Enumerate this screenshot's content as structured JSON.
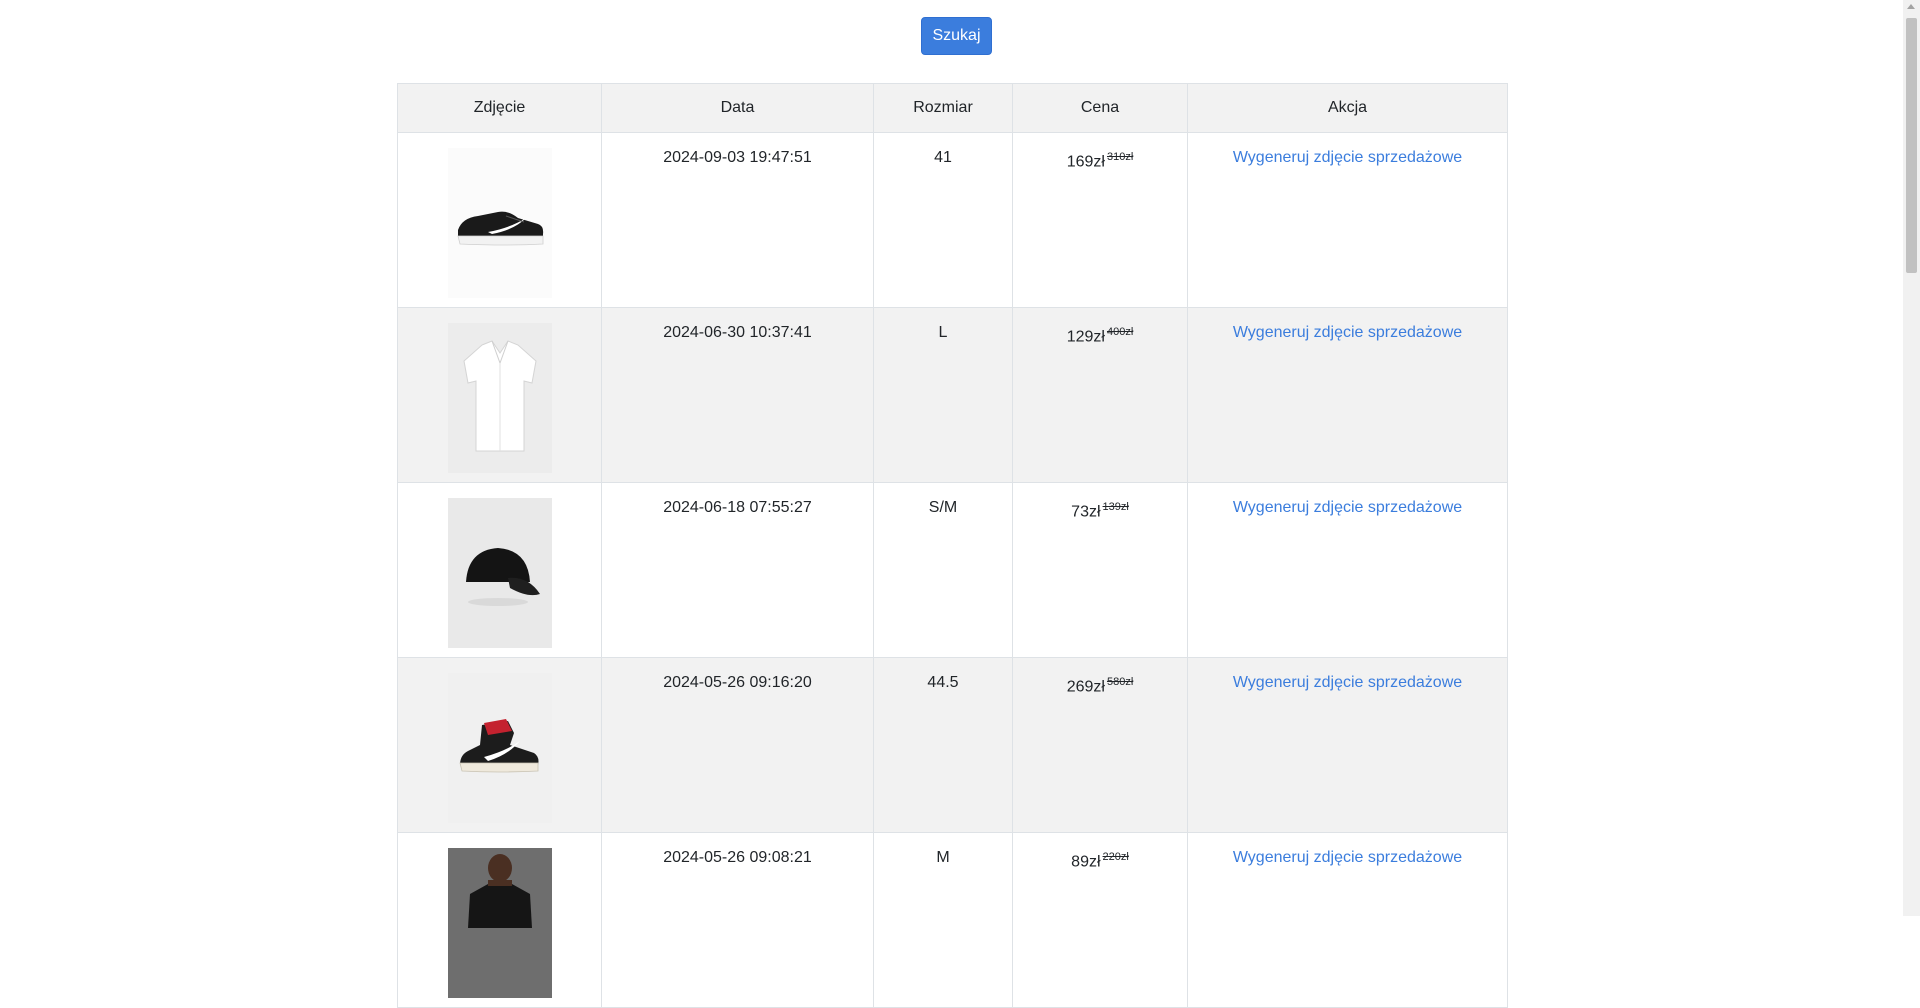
{
  "search": {
    "label": "Szukaj"
  },
  "table": {
    "headers": [
      "Zdjęcie",
      "Data",
      "Rozmiar",
      "Cena",
      "Akcja"
    ],
    "rows": [
      {
        "image": "black-white-sneaker-image",
        "date": "2024-09-03 19:47:51",
        "size": "41",
        "price": "169zł",
        "old_price": "310zł",
        "action": "Wygeneruj zdjęcie sprzedażowe"
      },
      {
        "image": "white-shirt-image",
        "date": "2024-06-30 10:37:41",
        "size": "L",
        "price": "129zł",
        "old_price": "400zł",
        "action": "Wygeneruj zdjęcie sprzedażowe"
      },
      {
        "image": "black-cap-image",
        "date": "2024-06-18 07:55:27",
        "size": "S/M",
        "price": "73zł",
        "old_price": "139zł",
        "action": "Wygeneruj zdjęcie sprzedażowe"
      },
      {
        "image": "red-high-top-sneaker-image",
        "date": "2024-05-26 09:16:20",
        "size": "44.5",
        "price": "269zł",
        "old_price": "580zł",
        "action": "Wygeneruj zdjęcie sprzedażowe"
      },
      {
        "image": "black-tshirt-model-image",
        "date": "2024-05-26 09:08:21",
        "size": "M",
        "price": "89zł",
        "old_price": "220zł",
        "action": "Wygeneruj zdjęcie sprzedażowe"
      }
    ]
  },
  "colors": {
    "accent": "#3b7ddd",
    "header_bg": "#f2f2f2",
    "row_alt_bg": "#f2f2f2"
  }
}
